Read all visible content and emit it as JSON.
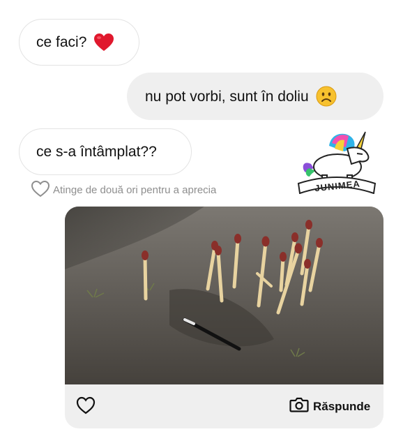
{
  "messages": [
    {
      "text": "ce faci?",
      "emoji": "red-heart"
    },
    {
      "text": "nu pot vorbi, sunt în doliu",
      "emoji": "frowning-face"
    },
    {
      "text": "ce s-a întâmplat??"
    }
  ],
  "reaction_hint": "Atinge de două ori pentru a aprecia",
  "logo": {
    "text": "JUNIMEA"
  },
  "photo_message": {
    "reply_label": "Răspunde"
  },
  "colors": {
    "incoming_border": "#e3e3e3",
    "outgoing_bg": "#efefef",
    "hint_text": "#8e8e8e",
    "heart": "#e0182d"
  }
}
